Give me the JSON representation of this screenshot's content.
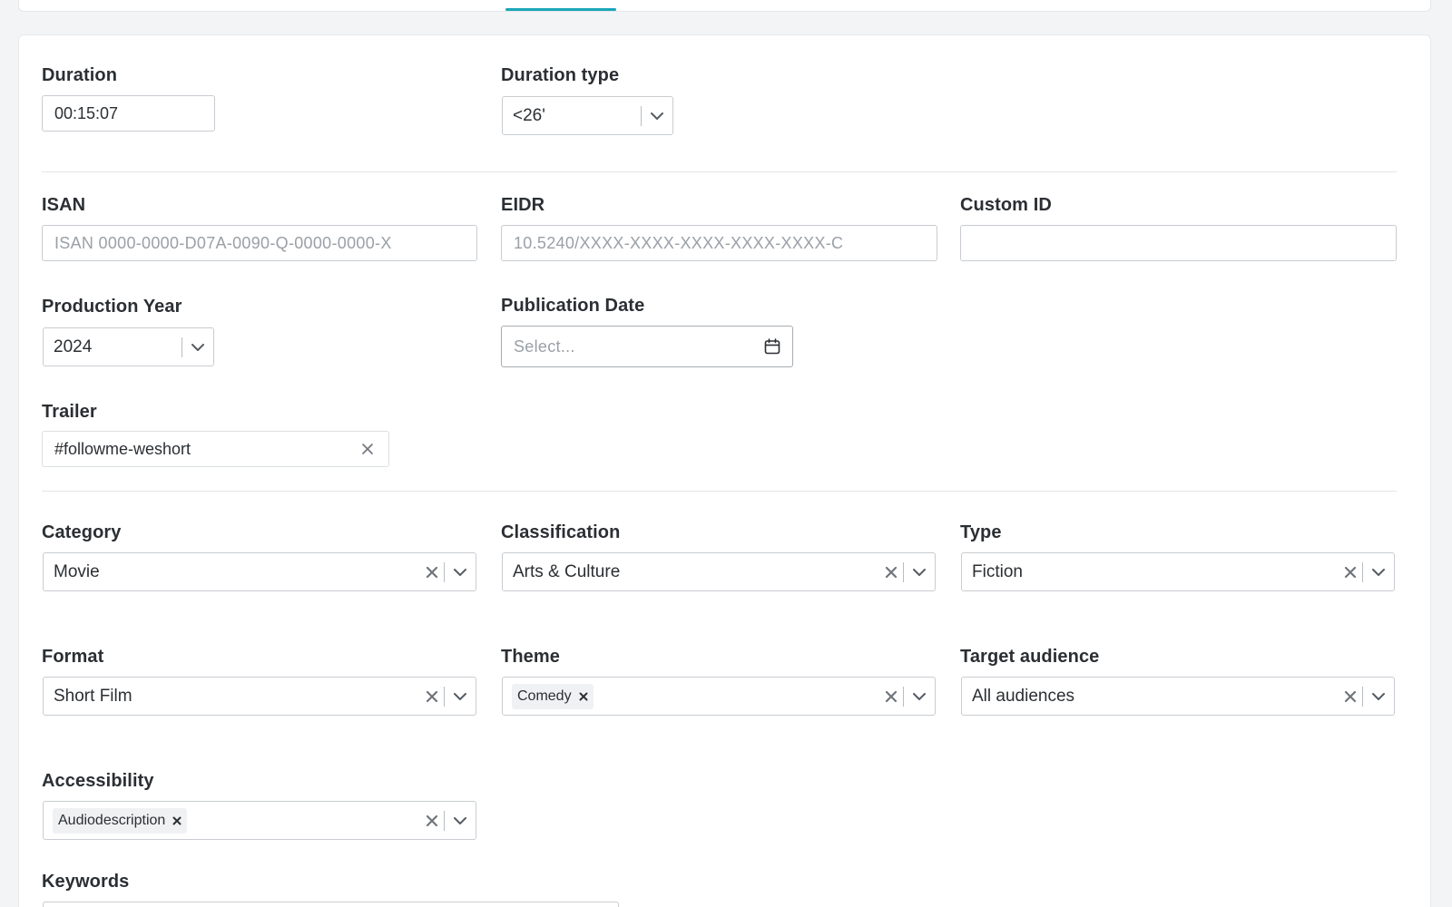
{
  "form": {
    "duration": {
      "label": "Duration",
      "value": "00:15:07"
    },
    "duration_type": {
      "label": "Duration type",
      "value": "<26'"
    },
    "isan": {
      "label": "ISAN",
      "placeholder": "ISAN 0000-0000-D07A-0090-Q-0000-0000-X"
    },
    "eidr": {
      "label": "EIDR",
      "placeholder": "10.5240/XXXX-XXXX-XXXX-XXXX-XXXX-C"
    },
    "custom_id": {
      "label": "Custom ID",
      "value": ""
    },
    "production_year": {
      "label": "Production Year",
      "value": "2024"
    },
    "publication_date": {
      "label": "Publication Date",
      "placeholder": "Select..."
    },
    "trailer": {
      "label": "Trailer",
      "value": "#followme-weshort"
    },
    "category": {
      "label": "Category",
      "value": "Movie"
    },
    "classification": {
      "label": "Classification",
      "value": "Arts & Culture"
    },
    "type": {
      "label": "Type",
      "value": "Fiction"
    },
    "format": {
      "label": "Format",
      "value": "Short Film"
    },
    "theme": {
      "label": "Theme",
      "chips": [
        "Comedy"
      ]
    },
    "target_audience": {
      "label": "Target audience",
      "value": "All audiences"
    },
    "accessibility": {
      "label": "Accessibility",
      "chips": [
        "Audiodescription"
      ]
    },
    "keywords": {
      "label": "Keywords"
    }
  },
  "colors": {
    "accent": "#1aa6b7",
    "border": "#c8ccd0",
    "text": "#2b2f33",
    "placeholder": "#9aa0a6"
  }
}
